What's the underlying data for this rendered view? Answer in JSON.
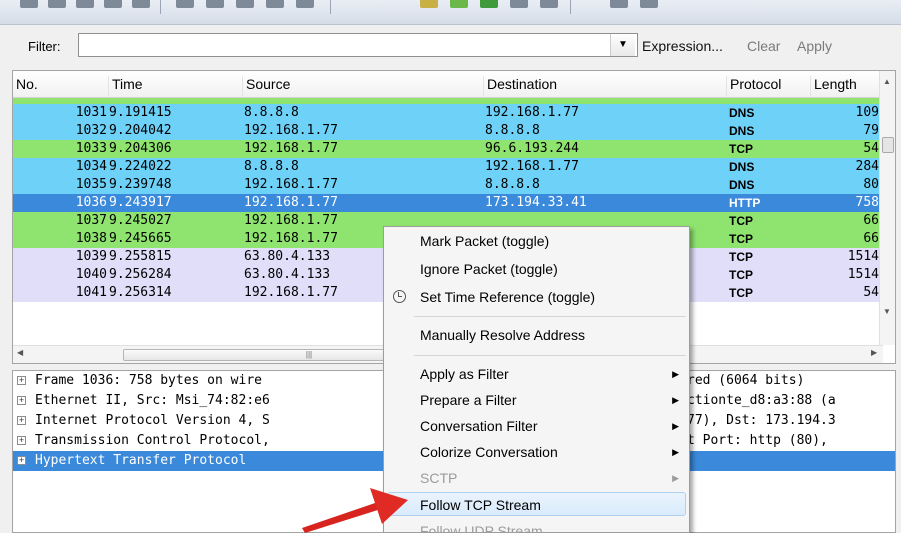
{
  "filter": {
    "label": "Filter:",
    "value": "",
    "expression_label": "Expression...",
    "clear_label": "Clear",
    "apply_label": "Apply"
  },
  "columns": [
    "No.",
    "Time",
    "Source",
    "Destination",
    "Protocol",
    "Length"
  ],
  "packets": [
    {
      "no": "1031",
      "time": "9.191415",
      "src": "8.8.8.8",
      "dst": "192.168.1.77",
      "proto": "DNS",
      "len": "109"
    },
    {
      "no": "1032",
      "time": "9.204042",
      "src": "192.168.1.77",
      "dst": "8.8.8.8",
      "proto": "DNS",
      "len": "79"
    },
    {
      "no": "1033",
      "time": "9.204306",
      "src": "192.168.1.77",
      "dst": "96.6.193.244",
      "proto": "TCP",
      "len": "54"
    },
    {
      "no": "1034",
      "time": "9.224022",
      "src": "8.8.8.8",
      "dst": "192.168.1.77",
      "proto": "DNS",
      "len": "284"
    },
    {
      "no": "1035",
      "time": "9.239748",
      "src": "192.168.1.77",
      "dst": "8.8.8.8",
      "proto": "DNS",
      "len": "80"
    },
    {
      "no": "1036",
      "time": "9.243917",
      "src": "192.168.1.77",
      "dst": "173.194.33.41",
      "proto": "HTTP",
      "len": "758"
    },
    {
      "no": "1037",
      "time": "9.245027",
      "src": "192.168.1.77",
      "dst": "",
      "proto": "TCP",
      "len": "66"
    },
    {
      "no": "1038",
      "time": "9.245665",
      "src": "192.168.1.77",
      "dst": "",
      "proto": "TCP",
      "len": "66"
    },
    {
      "no": "1039",
      "time": "9.255815",
      "src": "63.80.4.133",
      "dst": "",
      "proto": "TCP",
      "len": "1514"
    },
    {
      "no": "1040",
      "time": "9.256284",
      "src": "63.80.4.133",
      "dst": "",
      "proto": "TCP",
      "len": "1514"
    },
    {
      "no": "1041",
      "time": "9.256314",
      "src": "192.168.1.77",
      "dst": "",
      "proto": "TCP",
      "len": "54"
    }
  ],
  "details": [
    {
      "left": "Frame 1036: 758 bytes on wire",
      "right": "red (6064 bits)"
    },
    {
      "left": "Ethernet II, Src: Msi_74:82:e6",
      "right": "ctionte_d8:a3:88 (a"
    },
    {
      "left": "Internet Protocol Version 4, S",
      "right": "77), Dst: 173.194.3"
    },
    {
      "left": "Transmission Control Protocol,",
      "right": "t Port: http (80),"
    },
    {
      "left": "Hypertext Transfer Protocol",
      "right": ""
    }
  ],
  "menu": {
    "mark_packet": "Mark Packet (toggle)",
    "ignore_packet": "Ignore Packet (toggle)",
    "set_time_ref": "Set Time Reference (toggle)",
    "resolve_address": "Manually Resolve Address",
    "apply_as_filter": "Apply as Filter",
    "prepare_filter": "Prepare a Filter",
    "conversation_filter": "Conversation Filter",
    "colorize_conversation": "Colorize Conversation",
    "sctp": "SCTP",
    "follow_tcp": "Follow TCP Stream",
    "follow_udp": "Follow UDP Stream"
  },
  "colors": {
    "dns": "#6ed2f8",
    "tcp": "#8ee46f",
    "tcp_light": "#e0def8",
    "selected": "#3a89da",
    "arrow": "#e02020"
  }
}
